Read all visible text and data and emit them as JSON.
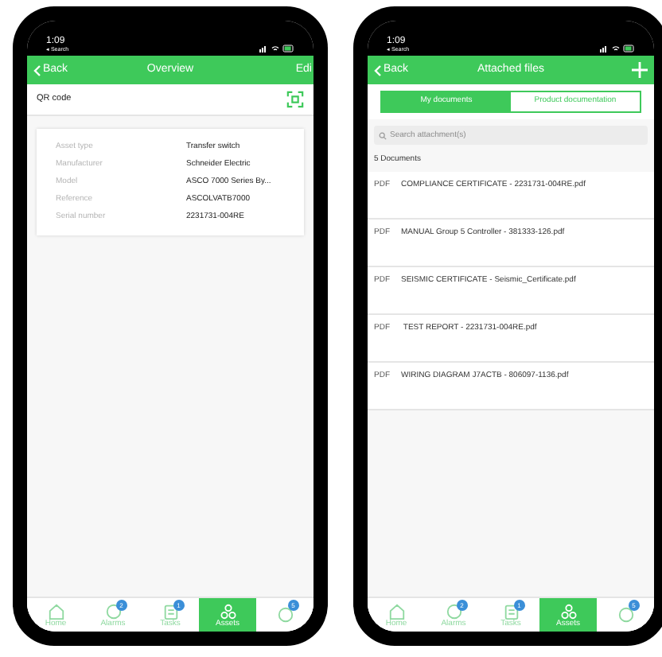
{
  "phones": [
    {
      "kind": "overview",
      "status_bar": {
        "time": "1:09",
        "back_app": "◂ Search"
      },
      "header": {
        "back": "Back",
        "title": "Overview",
        "action": "Edi"
      },
      "qr_row": {
        "label": "QR code"
      },
      "details": [
        {
          "label": "Asset type",
          "value": "Transfer switch"
        },
        {
          "label": "Manufacturer",
          "value": "Schneider Electric"
        },
        {
          "label": "Model",
          "value": "ASCO 7000 Series By..."
        },
        {
          "label": "Reference",
          "value": "ASCOLVATB7000"
        },
        {
          "label": "Serial number",
          "value": "2231731-004RE"
        }
      ],
      "nav": [
        {
          "kind": "home",
          "label": "Home",
          "selected": false
        },
        {
          "kind": "alarms",
          "label": "Alarms",
          "badge": "2",
          "selected": false
        },
        {
          "kind": "tasks",
          "label": "Tasks",
          "badge": "1",
          "selected": false
        },
        {
          "kind": "assets",
          "label": "Assets",
          "selected": true
        },
        {
          "kind": "more",
          "badge": "5",
          "selected": false
        }
      ]
    },
    {
      "kind": "attachments",
      "status_bar": {
        "time": "1:09",
        "back_app": "◂ Search"
      },
      "header": {
        "back": "Back",
        "title": "Attached files"
      },
      "tabs": [
        {
          "label": "My documents",
          "selected": true
        },
        {
          "label": "Product documentation",
          "selected": false
        }
      ],
      "search": {
        "placeholder": "Search attachment(s)"
      },
      "count": "5 Documents",
      "documents": [
        {
          "type": "PDF",
          "name": "COMPLIANCE CERTIFICATE - 2231731-004RE.pdf"
        },
        {
          "type": "PDF",
          "name": "MANUAL Group 5 Controller - 381333-126.pdf"
        },
        {
          "type": "PDF",
          "name": "SEISMIC CERTIFICATE - Seismic_Certificate.pdf"
        },
        {
          "type": "PDF",
          "name": " TEST REPORT - 2231731-004RE.pdf"
        },
        {
          "type": "PDF",
          "name": "WIRING DIAGRAM J7ACTB - 806097-1136.pdf"
        }
      ],
      "nav": [
        {
          "kind": "home",
          "label": "Home",
          "selected": false
        },
        {
          "kind": "alarms",
          "label": "Alarms",
          "badge": "2",
          "selected": false
        },
        {
          "kind": "tasks",
          "label": "Tasks",
          "badge": "1",
          "selected": false
        },
        {
          "kind": "assets",
          "label": "Assets",
          "selected": true
        },
        {
          "kind": "more",
          "badge": "5",
          "selected": false
        }
      ]
    }
  ]
}
